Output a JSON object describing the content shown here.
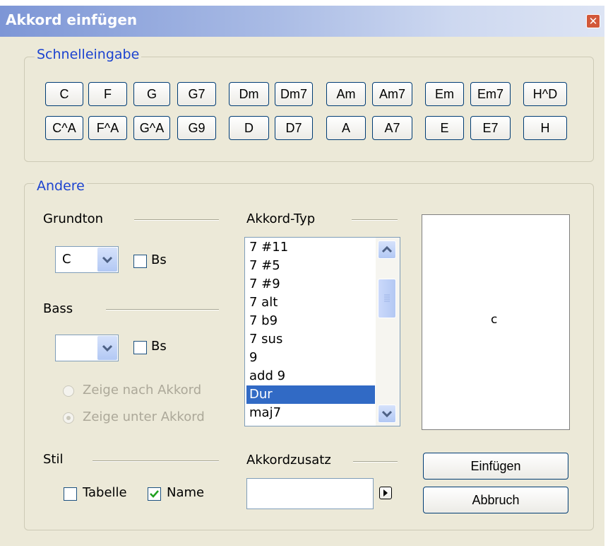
{
  "window": {
    "title": "Akkord einfügen"
  },
  "quick": {
    "legend": "Schnelleingabe",
    "row1": [
      "C",
      "F",
      "G",
      "G7",
      "Dm",
      "Dm7",
      "Am",
      "Am7",
      "Em",
      "Em7",
      "H^D"
    ],
    "row2": [
      "C^A",
      "F^A",
      "G^A",
      "G9",
      "D",
      "D7",
      "A",
      "A7",
      "E",
      "E7",
      "H"
    ]
  },
  "other": {
    "legend": "Andere",
    "root_label": "Grundton",
    "root_value": "C",
    "root_flat_label": "Bs",
    "bass_label": "Bass",
    "bass_value": "",
    "bass_flat_label": "Bs",
    "radio_after": "Zeige nach Akkord",
    "radio_under": "Zeige unter Akkord",
    "style_label": "Stil",
    "style_table": "Tabelle",
    "style_name": "Name",
    "type_label": "Akkord-Typ",
    "types": [
      "7 #11",
      "7 #5",
      "7 #9",
      "7 alt",
      "7 b9",
      "7 sus",
      "9",
      "add 9",
      "Dur",
      "maj7"
    ],
    "selected_type": "Dur",
    "suffix_label": "Akkordzusatz",
    "suffix_value": "",
    "preview_text": "c",
    "insert_button": "Einfügen",
    "cancel_button": "Abbruch"
  }
}
